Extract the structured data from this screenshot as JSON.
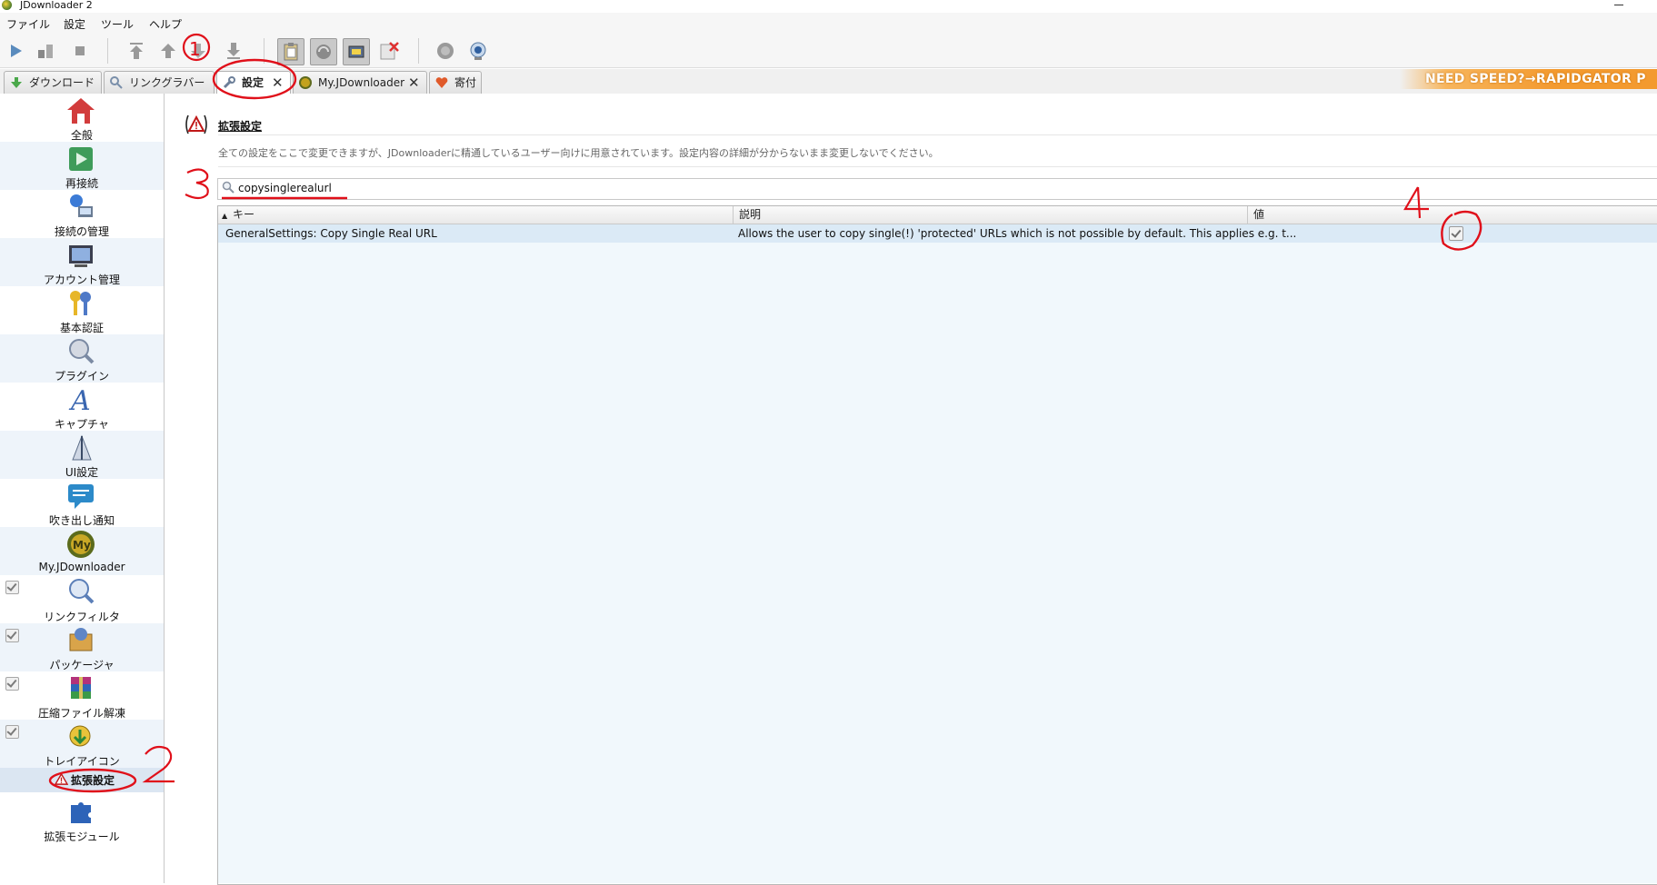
{
  "window": {
    "title": "JDownloader 2"
  },
  "menubar": {
    "items": [
      "ファイル",
      "設定",
      "ツール",
      "ヘルプ"
    ]
  },
  "toolbar": {
    "buttons": [
      "play-icon",
      "pause-icon",
      "stop-icon",
      "move-top-icon",
      "move-up-icon",
      "move-down-icon",
      "move-bottom-icon",
      "clipboard-icon",
      "reconnect-icon",
      "silent-mode-icon",
      "disable-premium-icon",
      "refresh-icon",
      "update-icon"
    ]
  },
  "tabs": [
    {
      "label": "ダウンロード",
      "icon": "download-icon",
      "closable": false,
      "active": false
    },
    {
      "label": "リンクグラバー",
      "icon": "linkgrabber-icon",
      "closable": false,
      "active": false
    },
    {
      "label": "設定",
      "icon": "settings-wrench-icon",
      "closable": true,
      "active": true
    },
    {
      "label": "My.JDownloader",
      "icon": "myjd-icon",
      "closable": true,
      "active": false
    },
    {
      "label": "寄付",
      "icon": "donate-heart-icon",
      "closable": false,
      "active": false
    }
  ],
  "promo": {
    "text": "NEED SPEED?→RAPIDGATOR P"
  },
  "sidebar": {
    "items": [
      {
        "label": "全般",
        "icon": "home-icon",
        "checkbox": false
      },
      {
        "label": "再接続",
        "icon": "reconnect-icon",
        "checkbox": false
      },
      {
        "label": "接続の管理",
        "icon": "network-icon",
        "checkbox": false
      },
      {
        "label": "アカウント管理",
        "icon": "account-icon",
        "checkbox": false
      },
      {
        "label": "基本認証",
        "icon": "keys-icon",
        "checkbox": false
      },
      {
        "label": "プラグイン",
        "icon": "plugin-icon",
        "checkbox": false
      },
      {
        "label": "キャプチャ",
        "icon": "captcha-icon",
        "checkbox": false
      },
      {
        "label": "UI設定",
        "icon": "ui-settings-icon",
        "checkbox": false
      },
      {
        "label": "吹き出し通知",
        "icon": "bubble-icon",
        "checkbox": false
      },
      {
        "label": "My.JDownloader",
        "icon": "myjd-icon",
        "checkbox": false
      },
      {
        "label": "リンクフィルタ",
        "icon": "linkfilter-icon",
        "checkbox": true
      },
      {
        "label": "パッケージャ",
        "icon": "packager-icon",
        "checkbox": true
      },
      {
        "label": "圧縮ファイル解凍",
        "icon": "archive-icon",
        "checkbox": true
      },
      {
        "label": "トレイアイコン",
        "icon": "tray-icon",
        "checkbox": true
      }
    ],
    "selected": {
      "label": "拡張設定",
      "icon": "warning-icon"
    },
    "extra": {
      "label": "拡張モジュール",
      "icon": "puzzle-icon"
    }
  },
  "content": {
    "title": "拡張設定",
    "description": "全ての設定をここで変更できますが、JDownloaderに精通しているユーザー向けに用意されています。設定内容の詳細が分からないまま変更しないでください。",
    "search": {
      "value": "copysinglerealurl",
      "placeholder": ""
    },
    "table": {
      "columns": [
        "キー",
        "説明",
        "値"
      ],
      "sort_column": "キー",
      "rows": [
        {
          "key": "GeneralSettings: Copy Single Real URL",
          "description": "Allows the user to copy single(!) 'protected' URLs which is not possible by default. This applies e.g. t...",
          "value": true
        }
      ]
    }
  },
  "annotations": {
    "color": "#e0101a",
    "labels": [
      "1",
      "2",
      "3",
      "4"
    ]
  }
}
